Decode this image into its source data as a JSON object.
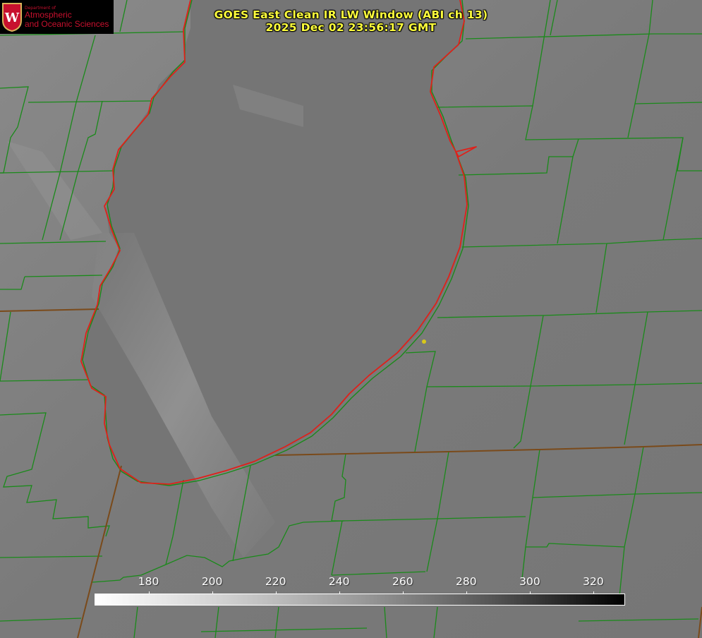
{
  "header": {
    "title_line1": "GOES East Clean IR LW Window (ABI ch 13)",
    "title_line2": "2025 Dec 02 23:56:17 GMT",
    "title_color": "#ffff3c"
  },
  "logo": {
    "department": "Department of",
    "line1": "Atmospheric",
    "line2": "and Oceanic Sciences",
    "seal_letter": "W",
    "brand_color": "#c8102e"
  },
  "colorbar": {
    "ticks": [
      "180",
      "200",
      "220",
      "240",
      "260",
      "280",
      "300",
      "320"
    ],
    "tick_values": [
      180,
      200,
      220,
      240,
      260,
      280,
      300,
      320
    ],
    "range": [
      163,
      330
    ],
    "scale": "white-to-black"
  },
  "map": {
    "boundary_color": "#1a8a1a",
    "coastline_color": "#e0201a",
    "marker_color": "#d8c81a"
  }
}
